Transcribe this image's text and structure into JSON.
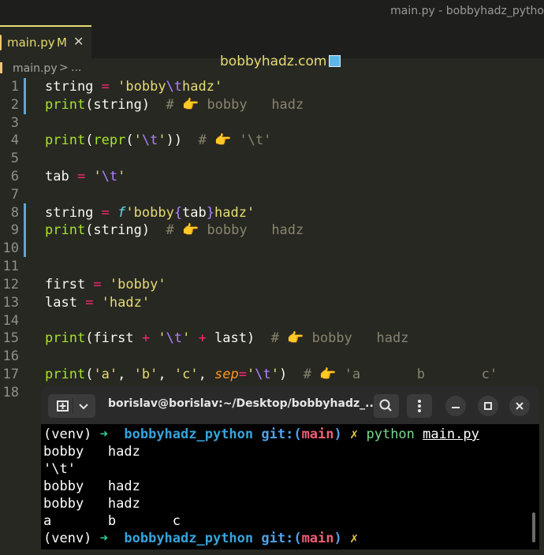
{
  "window": {
    "title": "main.py - bobbyhadz_pytho"
  },
  "tab": {
    "label": "main.py",
    "modified": "M",
    "close": "✕"
  },
  "watermark": "bobbyhadz.com",
  "breadcrumb": {
    "file": "main.py",
    "sep": ">",
    "more": "..."
  },
  "editor": {
    "line_numbers": [
      "1",
      "2",
      "3",
      "4",
      "5",
      "6",
      "7",
      "8",
      "9",
      "10",
      "11",
      "12",
      "13",
      "14",
      "15",
      "16",
      "17",
      "18"
    ]
  },
  "code": {
    "l1": {
      "var": "string",
      "eq": " = ",
      "q1": "'bobby",
      "esc": "\\t",
      "q2": "hadz'"
    },
    "l2": {
      "fn": "print",
      "args": "(string)",
      "cm_hash": "  # ",
      "cm_emoji": "👉",
      "cm_text": " bobby   hadz"
    },
    "l4": {
      "fn": "print",
      "p1": "(",
      "fn2": "repr",
      "p2": "(",
      "q1": "'",
      "esc": "\\t",
      "q2": "'",
      "p3": "))",
      "cm_hash": "  # ",
      "cm_emoji": "👉",
      "cm_text": " '\\t'"
    },
    "l6": {
      "var": "tab",
      "eq": " = ",
      "q1": "'",
      "esc": "\\t",
      "q2": "'"
    },
    "l8": {
      "var": "string",
      "eq": " = ",
      "prefix": "f",
      "s1": "'bobby",
      "lb": "{",
      "expr": "tab",
      "rb": "}",
      "s2": "hadz'"
    },
    "l9": {
      "fn": "print",
      "args": "(string)",
      "cm_hash": "  # ",
      "cm_emoji": "👉",
      "cm_text": " bobby   hadz"
    },
    "l12": {
      "var": "first",
      "eq": " = ",
      "str": "'bobby'"
    },
    "l13": {
      "var": "last",
      "eq": " = ",
      "str": "'hadz'"
    },
    "l15": {
      "fn": "print",
      "a1": "(first ",
      "plus1": "+",
      "sp1": " ",
      "q1": "'",
      "esc": "\\t",
      "q2": "'",
      "sp2": " ",
      "plus2": "+",
      "a2": " last)",
      "cm_hash": "  # ",
      "cm_emoji": "👉",
      "cm_text": " bobby   hadz"
    },
    "l17": {
      "fn": "print",
      "p1": "(",
      "s1": "'a'",
      "c1": ", ",
      "s2": "'b'",
      "c2": ", ",
      "s3": "'c'",
      "c3": ", ",
      "kw": "sep",
      "eq": "=",
      "q1": "'",
      "esc": "\\t",
      "q2": "'",
      "p2": ")",
      "cm_hash": "  # ",
      "cm_emoji": "👉",
      "cm_text": " 'a       b       c'"
    }
  },
  "terminal": {
    "title": "borislav@borislav:~/Desktop/bobbyhadz_...",
    "icons": {
      "new_tab": "new-tab-icon",
      "dropdown": "chevron-down-icon",
      "search": "search-icon",
      "menu": "kebab-menu-icon",
      "minimize": "minimize-icon",
      "maximize": "maximize-icon",
      "close": "close-icon"
    },
    "prompt": {
      "venv": "(venv) ",
      "arrow": "➜",
      "dir": "  bobbyhadz_python",
      "git": " git:(",
      "branch": "main",
      "git_end": ")",
      "mark": " ✗ "
    },
    "command": {
      "cmd": "python",
      "arg": "main.py"
    },
    "output": [
      "bobby   hadz",
      "'\\t'",
      "bobby   hadz",
      "bobby   hadz",
      "a       b       c"
    ]
  }
}
